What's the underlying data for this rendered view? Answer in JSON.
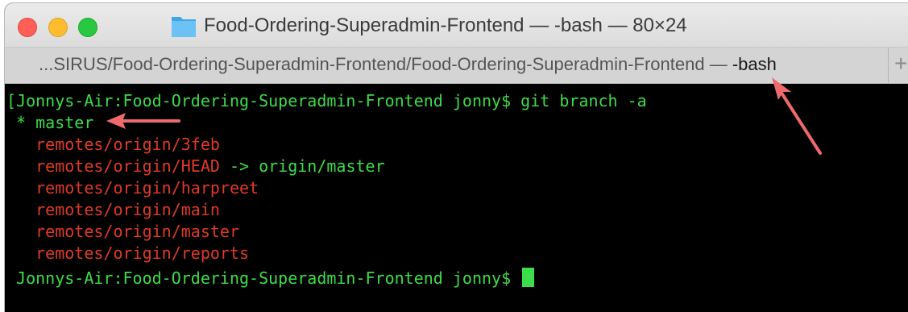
{
  "window": {
    "title": "Food-Ordering-Superadmin-Frontend — -bash — 80×24",
    "folder_icon": "folder-icon"
  },
  "tab": {
    "path": "...SIRUS/Food-Ordering-Superadmin-Frontend/Food-Ordering-Superadmin-Frontend —",
    "process": " -bash",
    "add_label": "+"
  },
  "terminal": {
    "lines": [
      {
        "text": "[Jonnys-Air:Food-Ordering-Superadmin-Frontend jonny$ git branch -a",
        "color": "green"
      },
      {
        "text": " * master",
        "color": "green"
      },
      {
        "text": "   remotes/origin/3feb",
        "color": "red"
      },
      {
        "text": "   remotes/origin/HEAD",
        "color": "red",
        "suffix": " -> origin/master",
        "suffix_color": "green"
      },
      {
        "text": "   remotes/origin/harpreet",
        "color": "red"
      },
      {
        "text": "   remotes/origin/main",
        "color": "red"
      },
      {
        "text": "   remotes/origin/master",
        "color": "red"
      },
      {
        "text": "   remotes/origin/reports",
        "color": "red"
      },
      {
        "text": " Jonnys-Air:Food-Ordering-Superadmin-Frontend jonny$ ",
        "color": "green"
      }
    ]
  },
  "colors": {
    "background": "#000000",
    "prompt_green": "#3ddc4a",
    "remote_red": "#e03a26",
    "annotation_arrow": "#ef6b6b"
  }
}
